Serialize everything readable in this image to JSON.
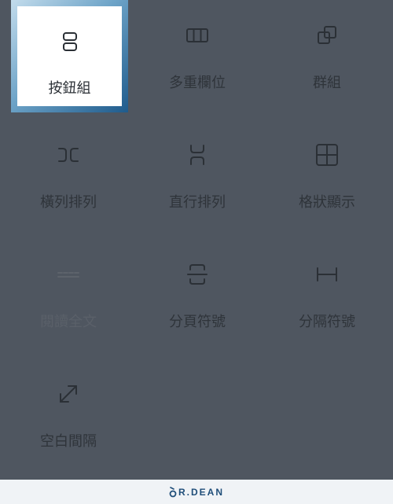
{
  "blocks": [
    {
      "label": "按鈕組",
      "icon": "button-group-icon",
      "state": "selected"
    },
    {
      "label": "多重欄位",
      "icon": "columns-icon",
      "state": "normal"
    },
    {
      "label": "群組",
      "icon": "group-icon",
      "state": "normal"
    },
    {
      "label": "橫列排列",
      "icon": "row-icon",
      "state": "normal"
    },
    {
      "label": "直行排列",
      "icon": "stack-icon",
      "state": "normal"
    },
    {
      "label": "格狀顯示",
      "icon": "grid-icon",
      "state": "normal"
    },
    {
      "label": "閱讀全文",
      "icon": "more-icon",
      "state": "disabled"
    },
    {
      "label": "分頁符號",
      "icon": "page-break-icon",
      "state": "normal"
    },
    {
      "label": "分隔符號",
      "icon": "separator-icon",
      "state": "normal"
    },
    {
      "label": "空白間隔",
      "icon": "spacer-icon",
      "state": "normal"
    }
  ],
  "footer": {
    "brand": "R.DEAN",
    "brand_color": "#1f4e79"
  },
  "colors": {
    "background": "#4f5660",
    "selected_border": "#2e6fa5",
    "footer_background": "#f0f3f6"
  }
}
